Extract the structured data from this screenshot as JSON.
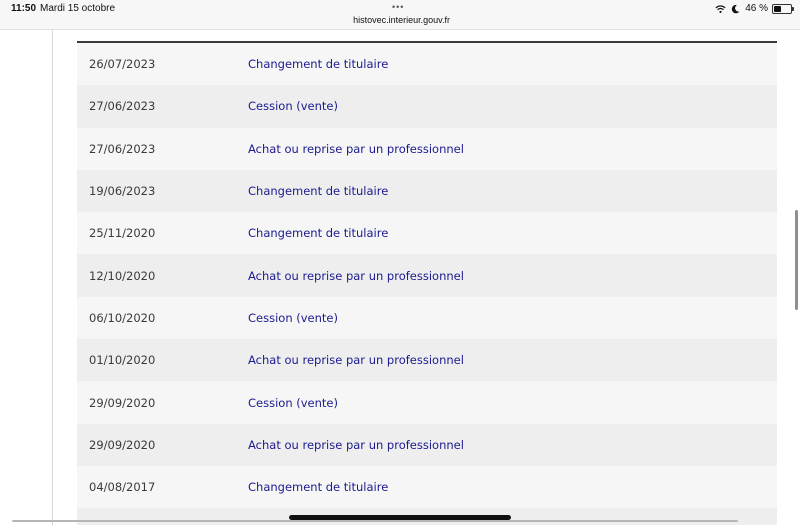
{
  "status_bar": {
    "time": "11:50",
    "date": "Mardi 15 octobre",
    "dots": "•••",
    "url": "histovec.interieur.gouv.fr",
    "battery": "46 %",
    "battery_level": 0.46
  },
  "history": {
    "rows": [
      {
        "date": "26/07/2023",
        "operation": "Changement de titulaire"
      },
      {
        "date": "27/06/2023",
        "operation": "Cession (vente)"
      },
      {
        "date": "27/06/2023",
        "operation": "Achat ou reprise par un professionnel"
      },
      {
        "date": "19/06/2023",
        "operation": "Changement de titulaire"
      },
      {
        "date": "25/11/2020",
        "operation": "Changement de titulaire"
      },
      {
        "date": "12/10/2020",
        "operation": "Achat ou reprise par un professionnel"
      },
      {
        "date": "06/10/2020",
        "operation": "Cession (vente)"
      },
      {
        "date": "01/10/2020",
        "operation": "Achat ou reprise par un professionnel"
      },
      {
        "date": "29/09/2020",
        "operation": "Cession (vente)"
      },
      {
        "date": "29/09/2020",
        "operation": "Achat ou reprise par un professionnel"
      },
      {
        "date": "04/08/2017",
        "operation": "Changement de titulaire"
      }
    ]
  }
}
